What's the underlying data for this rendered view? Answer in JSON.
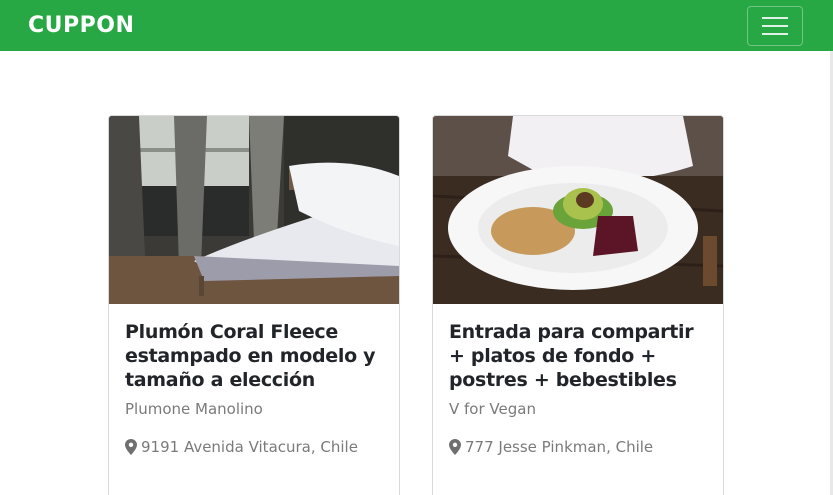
{
  "navbar": {
    "brand": "CUPPON",
    "toggler_icon": "hamburger-menu-icon",
    "color": "#28a745"
  },
  "cards": [
    {
      "title": "Plumón Coral Fleece estampado en modelo y tamaño a elección",
      "merchant": "Plumone Manolino",
      "location": "9191 Avenida Vitacura, Chile",
      "image": "bedroom-photo"
    },
    {
      "title": "Entrada para compartir + platos de fondo + postres + bebestibles",
      "merchant": "V for Vegan",
      "location": "777 Jesse Pinkman, Chile",
      "image": "salad-bowl-photo"
    }
  ]
}
